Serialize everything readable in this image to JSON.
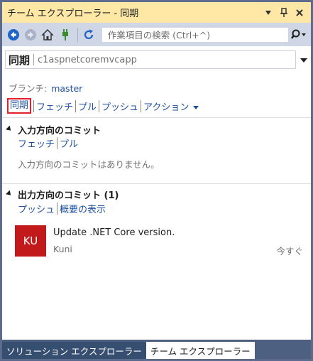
{
  "window": {
    "title": "チーム エクスプローラー - 同期"
  },
  "toolbar": {
    "search_placeholder": "作業項目の検索 (Ctrl+^)"
  },
  "header": {
    "section": "同期",
    "repo": "c1aspnetcoremvcapp"
  },
  "branch": {
    "label": "ブランチ:",
    "value": "master"
  },
  "actions": {
    "sync": "同期",
    "fetch": "フェッチ",
    "pull": "プル",
    "push": "プッシュ",
    "action": "アクション"
  },
  "incoming": {
    "title": "入力方向のコミット",
    "fetch": "フェッチ",
    "pull": "プル",
    "empty": "入力方向のコミットはありません。"
  },
  "outgoing": {
    "title": "出力方向のコミット (1)",
    "push": "プッシュ",
    "summary": "概要の表示",
    "commits": [
      {
        "initials": "KU",
        "message": "Update .NET Core version.",
        "author": "Kuni",
        "time": "今すぐ"
      }
    ]
  },
  "tabs": [
    {
      "label": "ソリューション エクスプローラー"
    },
    {
      "label": "チーム エクスプローラー"
    }
  ],
  "colors": {
    "accent": "#1e50a2",
    "title_bar": "#ffe8a6",
    "avatar": "#c21a1a",
    "highlight_box": "#e5202e"
  }
}
